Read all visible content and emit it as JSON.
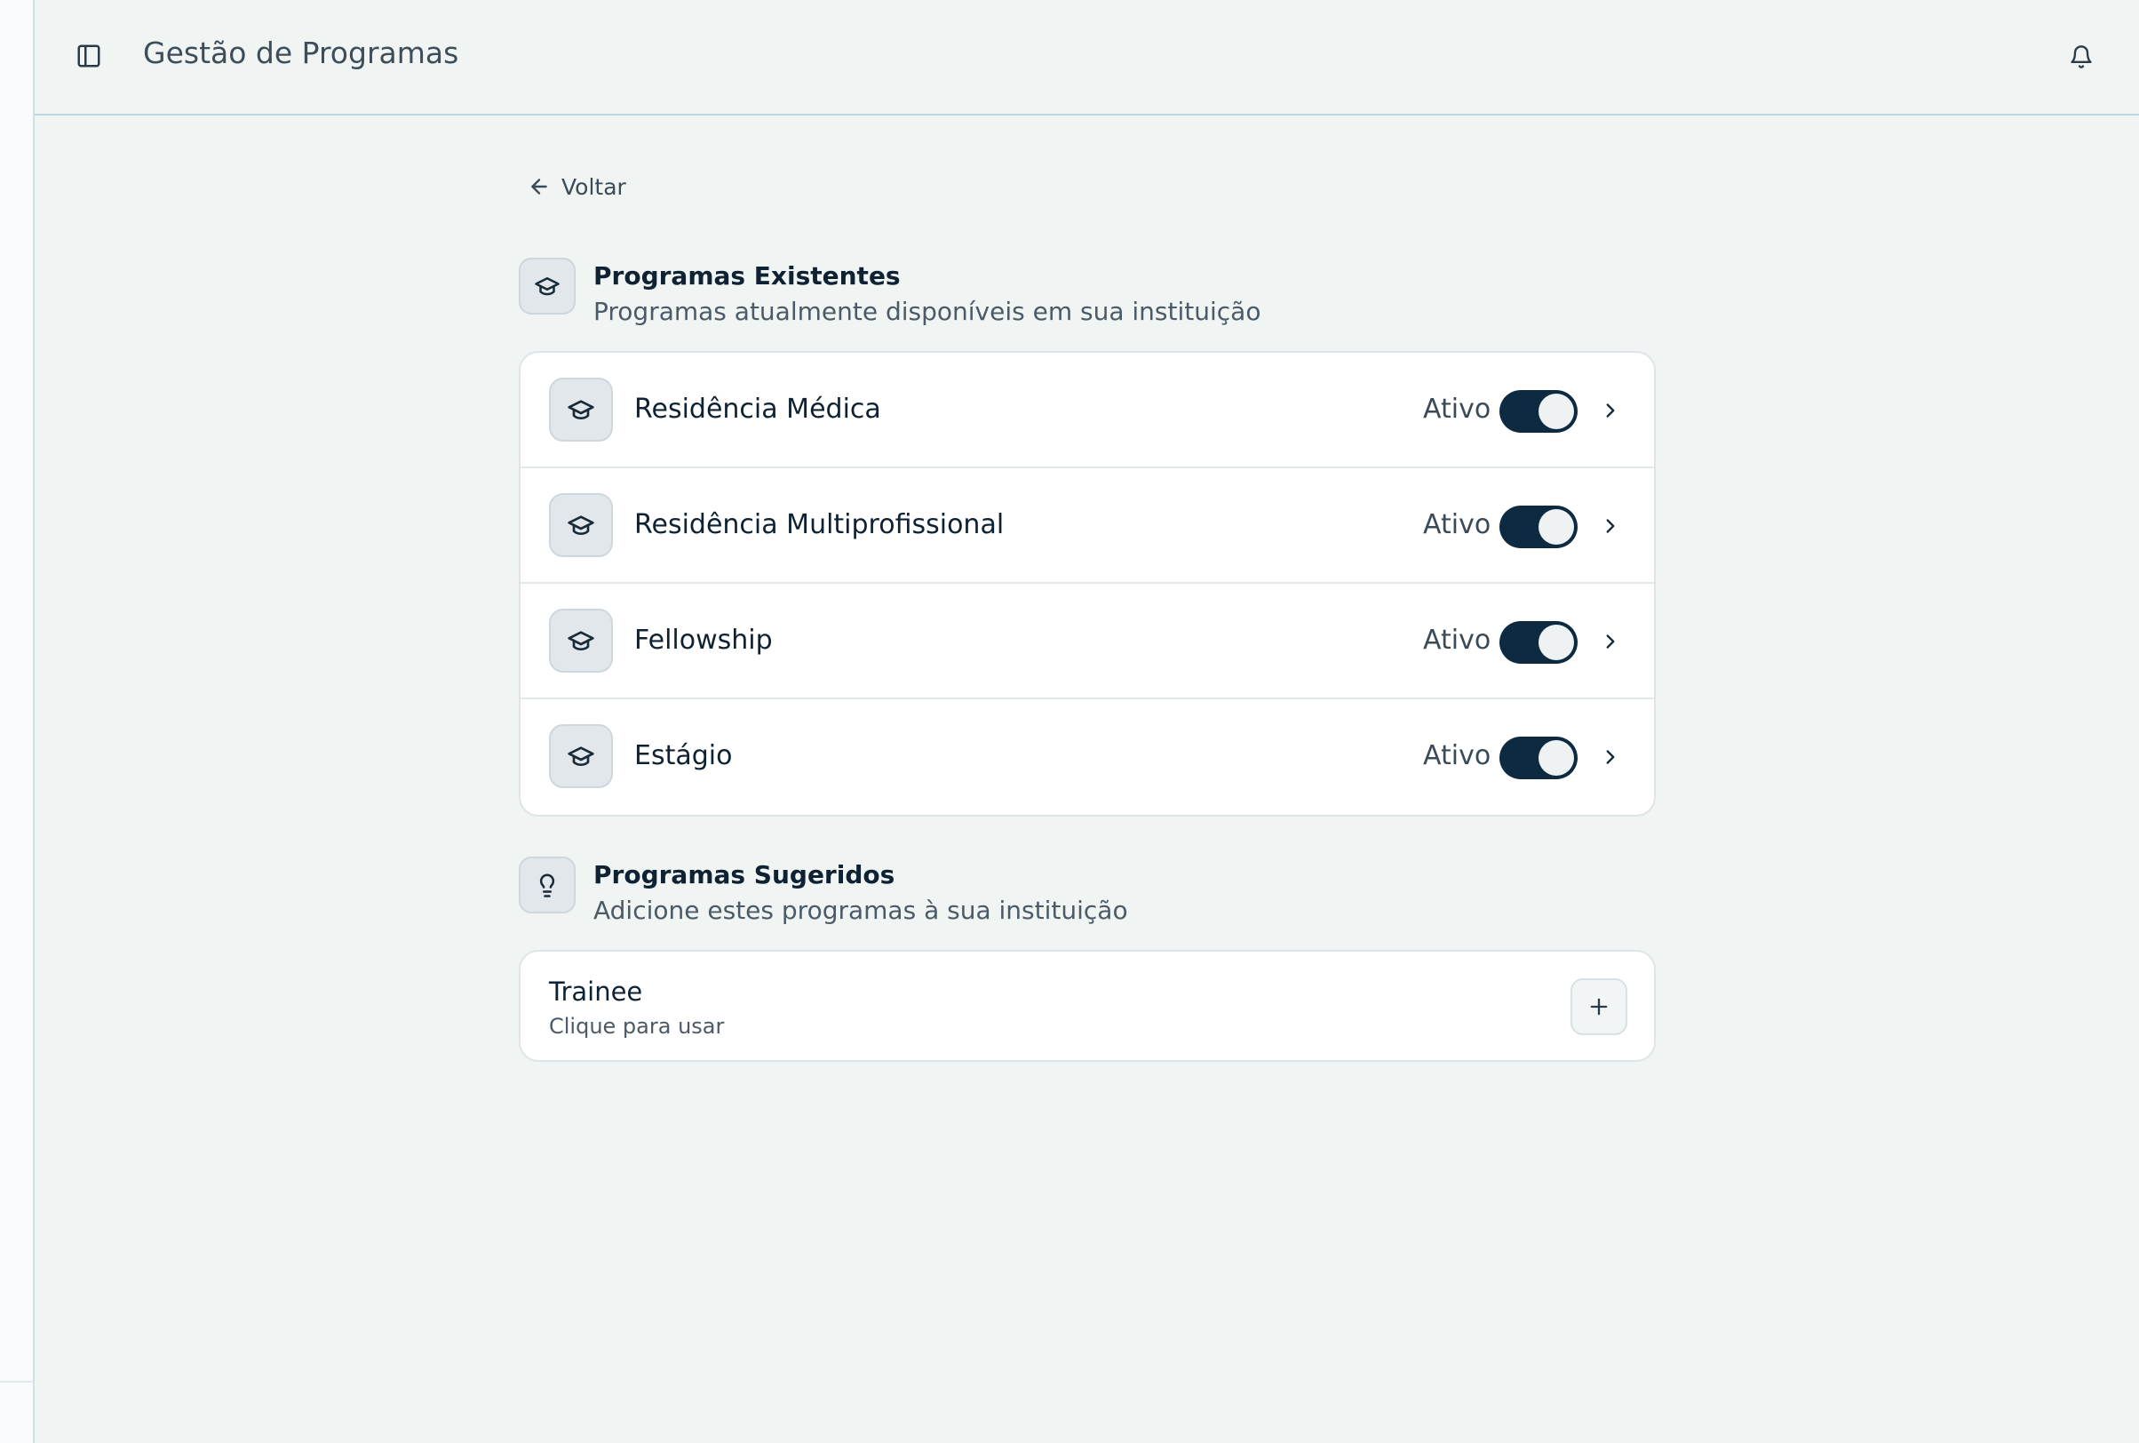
{
  "header": {
    "title": "Gestão de Programas",
    "sidebar_toggle_icon": "sidebar-panel-icon",
    "notification_icon": "bell-icon"
  },
  "back": {
    "label": "Voltar",
    "icon": "arrow-left-icon"
  },
  "existing": {
    "title": "Programas Existentes",
    "subtitle": "Programas atualmente disponíveis em sua instituição",
    "icon": "graduation-cap-icon",
    "programs": [
      {
        "name": "Residência Médica",
        "status": "Ativo",
        "enabled": true
      },
      {
        "name": "Residência Multiprofissional",
        "status": "Ativo",
        "enabled": true
      },
      {
        "name": "Fellowship",
        "status": "Ativo",
        "enabled": true
      },
      {
        "name": "Estágio",
        "status": "Ativo",
        "enabled": true
      }
    ]
  },
  "suggested": {
    "title": "Programas Sugeridos",
    "subtitle": "Adicione estes programas à sua instituição",
    "icon": "lightbulb-icon",
    "items": [
      {
        "name": "Trainee",
        "hint": "Clique para usar",
        "action_icon": "plus-icon"
      }
    ]
  },
  "colors": {
    "background": "#f0f4f3",
    "toggle_on": "#0d2a40",
    "text_primary": "#0f2233",
    "text_secondary": "#4b5a66"
  }
}
